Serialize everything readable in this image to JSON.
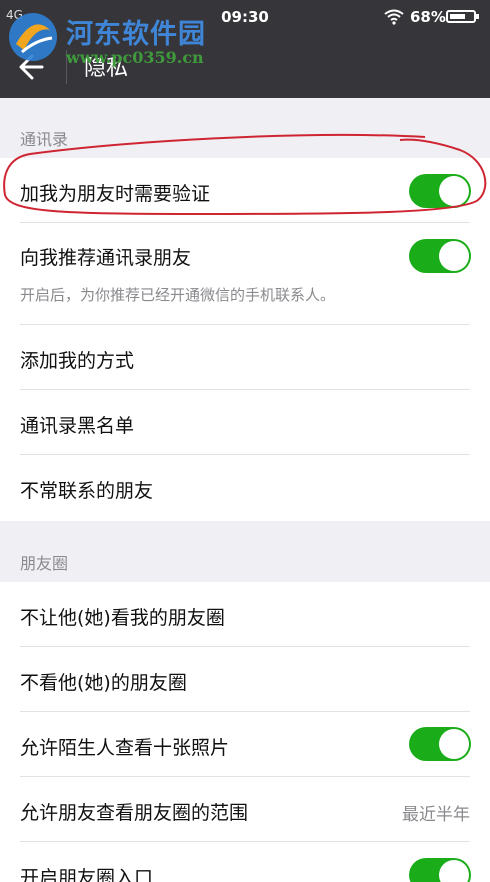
{
  "status": {
    "network": "4G",
    "time": "09:30",
    "battery": "68%",
    "battery_level": 0.68
  },
  "watermark": {
    "title": "河东软件园",
    "url": "www.pc0359.cn"
  },
  "nav": {
    "title": "隐私"
  },
  "contacts": {
    "header": "通讯录",
    "verify_label": "加我为朋友时需要验证",
    "verify_on": true,
    "recommend_label": "向我推荐通讯录朋友",
    "recommend_on": true,
    "recommend_desc": "开启后，为你推荐已经开通微信的手机联系人。",
    "add_methods_label": "添加我的方式",
    "blacklist_label": "通讯录黑名单",
    "infrequent_label": "不常联系的朋友"
  },
  "moments": {
    "header": "朋友圈",
    "hide_mine_label": "不让他(她)看我的朋友圈",
    "hide_theirs_label": "不看他(她)的朋友圈",
    "strangers_label": "允许陌生人查看十张照片",
    "strangers_on": true,
    "range_label": "允许朋友查看朋友圈的范围",
    "range_value": "最近半年",
    "last_label": "开启朋友圈入口"
  }
}
